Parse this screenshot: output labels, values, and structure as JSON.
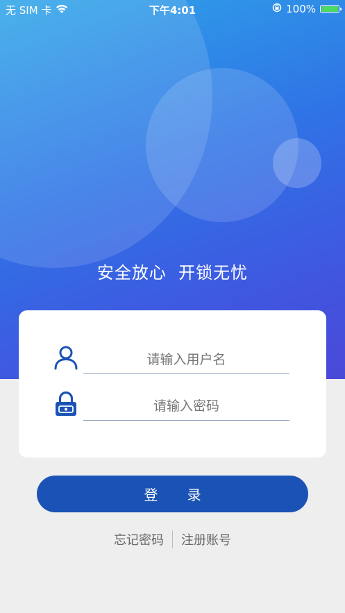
{
  "status_bar": {
    "carrier": "无 SIM 卡",
    "time": "下午4:01",
    "battery": "100%"
  },
  "hero": {
    "slogan": "安全放心  开锁无忧"
  },
  "login_form": {
    "username_placeholder": "请输入用户名",
    "password_placeholder": "请输入密码",
    "login_label": "登 录"
  },
  "links": {
    "forgot_password": "忘记密码",
    "register": "注册账号"
  },
  "colors": {
    "primary": "#1a53b5",
    "gradient_start": "#2fa6e8",
    "gradient_end": "#4a49d8",
    "icon": "#1a53b5"
  }
}
